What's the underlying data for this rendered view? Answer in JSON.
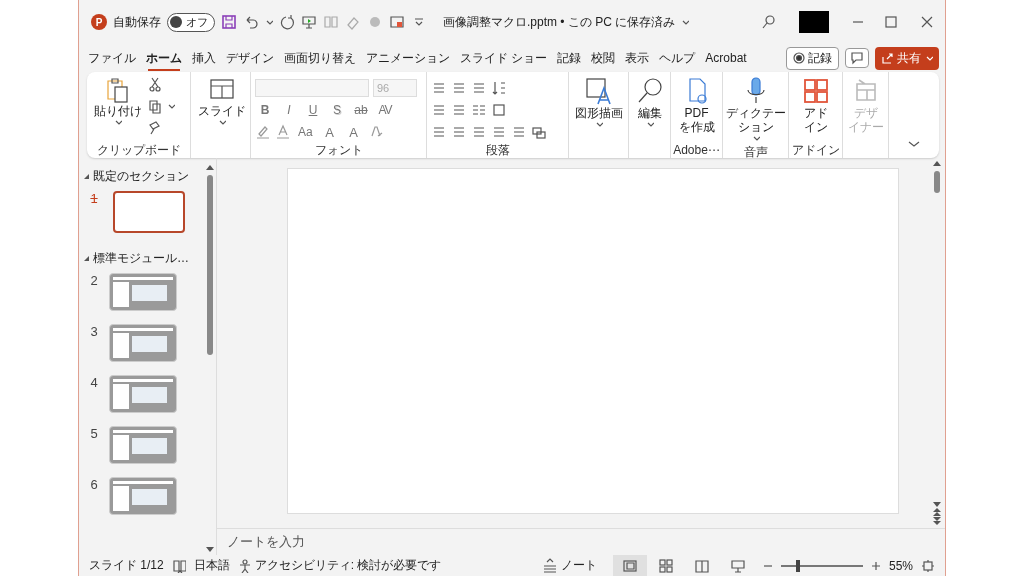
{
  "title_bar": {
    "app_badge": "P",
    "autosave_label": "自動保存",
    "autosave": {
      "label": "オフ",
      "on": false
    },
    "document_title": "画像調整マクロ.pptm • この PC に保存済み"
  },
  "menu_tabs": [
    {
      "label": "ファイル",
      "selected": false
    },
    {
      "label": "ホーム",
      "selected": true
    },
    {
      "label": "挿入",
      "selected": false
    },
    {
      "label": "デザイン",
      "selected": false
    },
    {
      "label": "画面切り替え",
      "selected": false
    },
    {
      "label": "アニメーション",
      "selected": false
    },
    {
      "label": "スライド ショー",
      "selected": false
    },
    {
      "label": "記録",
      "selected": false
    },
    {
      "label": "校閲",
      "selected": false
    },
    {
      "label": "表示",
      "selected": false
    },
    {
      "label": "ヘルプ",
      "selected": false
    },
    {
      "label": "Acrobat",
      "selected": false
    }
  ],
  "record_button": "記録",
  "share_button": "共有",
  "ribbon": {
    "clipboard": {
      "paste": "貼り付け",
      "group": "クリップボード"
    },
    "slides": {
      "new_slide": "スライド"
    },
    "font": {
      "font_size": "96",
      "row1": [
        "B",
        "I",
        "U",
        "S",
        "ab",
        "AV"
      ],
      "row2": [
        "Aa",
        "A",
        "A"
      ],
      "group": "フォント"
    },
    "paragraph": {
      "group": "段落"
    },
    "large_groups": [
      {
        "buttons": [
          {
            "kind": "shapes",
            "lines": [
              "図形描画"
            ],
            "dropdown": true,
            "disabled": false
          }
        ]
      },
      {
        "buttons": [
          {
            "kind": "search",
            "lines": [
              "編集"
            ],
            "dropdown": true,
            "disabled": false
          }
        ]
      },
      {
        "group": "Adobe⋯",
        "buttons": [
          {
            "kind": "pdf",
            "lines": [
              "PDF",
              "を作成"
            ],
            "dropdown": false,
            "disabled": false
          }
        ]
      },
      {
        "group": "音声",
        "buttons": [
          {
            "kind": "mic",
            "lines": [
              "ディクテー",
              "ション"
            ],
            "dropdown": true,
            "disabled": false
          }
        ]
      },
      {
        "group": "アドイン",
        "buttons": [
          {
            "kind": "addins",
            "lines": [
              "アド",
              "イン"
            ],
            "dropdown": false,
            "disabled": false
          }
        ]
      },
      {
        "buttons": [
          {
            "kind": "designer",
            "lines": [
              "デザ",
              "イナー"
            ],
            "dropdown": false,
            "disabled": true
          }
        ]
      }
    ]
  },
  "slide_panel": {
    "sections": [
      {
        "name": "既定のセクション",
        "slides": [
          {
            "number": "1",
            "hidden": true,
            "selected": true,
            "kind": "blank"
          }
        ]
      },
      {
        "name": "標準モジュール…",
        "slides": [
          {
            "number": "2",
            "hidden": false,
            "selected": false,
            "kind": "screenshot"
          },
          {
            "number": "3",
            "hidden": false,
            "selected": false,
            "kind": "screenshot"
          },
          {
            "number": "4",
            "hidden": false,
            "selected": false,
            "kind": "screenshot"
          },
          {
            "number": "5",
            "hidden": false,
            "selected": false,
            "kind": "screenshot"
          },
          {
            "number": "6",
            "hidden": false,
            "selected": false,
            "kind": "screenshot"
          }
        ]
      }
    ]
  },
  "notes": {
    "placeholder": "ノートを入力"
  },
  "status_bar": {
    "slide_indicator": "スライド 1/12",
    "language": "日本語",
    "accessibility": "アクセシビリティ: 検討が必要です",
    "notes_button": "ノート",
    "views": [
      {
        "kind": "normal",
        "selected": true
      },
      {
        "kind": "sorter",
        "selected": false
      },
      {
        "kind": "reading",
        "selected": false
      },
      {
        "kind": "show",
        "selected": false
      }
    ],
    "zoom": {
      "level": 0.18,
      "reading": "55%"
    }
  }
}
